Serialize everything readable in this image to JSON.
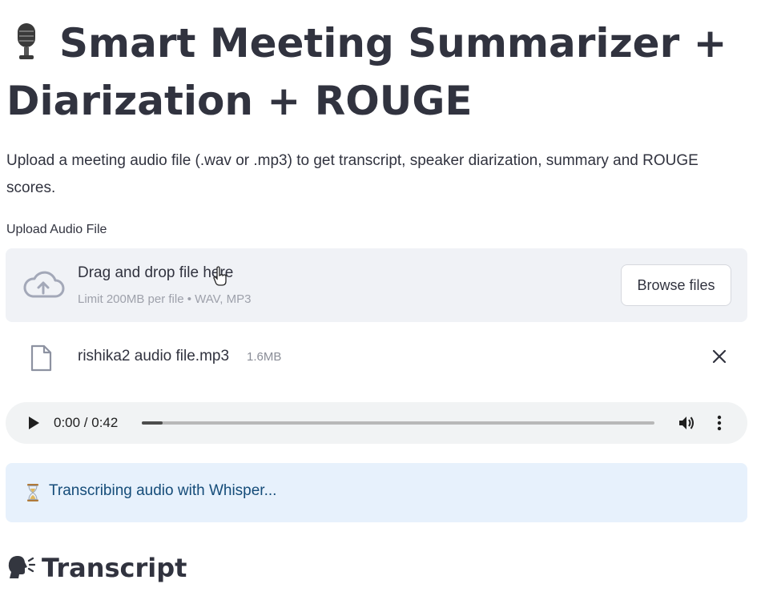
{
  "app": {
    "title_line1": "Smart Meeting Summarizer +",
    "title_line2": "Diarization + ROUGE",
    "description": "Upload a meeting audio file (.wav or .mp3) to get transcript, speaker diarization, summary and ROUGE scores."
  },
  "uploader": {
    "label": "Upload Audio File",
    "drop_text": "Drag and drop file here",
    "limit_text": "Limit 200MB per file • WAV, MP3",
    "browse_label": "Browse files"
  },
  "file": {
    "name": "rishika2 audio file.mp3",
    "size": "1.6MB"
  },
  "player": {
    "time": "0:00 / 0:42",
    "progress_fraction": 0.04
  },
  "status": {
    "message": "Transcribing audio with Whisper..."
  },
  "transcript": {
    "heading": "Transcript"
  },
  "icons": {
    "title": "microphone-icon",
    "upload": "cloud-upload-icon",
    "file": "file-icon",
    "remove": "close-icon",
    "play": "play-icon",
    "volume": "volume-icon",
    "more": "more-vertical-icon",
    "status": "hourglass-icon",
    "section": "speaking-head-icon"
  },
  "colors": {
    "text": "#31333f",
    "muted": "#9ea1ab",
    "dropzone_bg": "#f0f2f6",
    "info_bg": "#e7f1fc",
    "info_text": "#154c79"
  }
}
